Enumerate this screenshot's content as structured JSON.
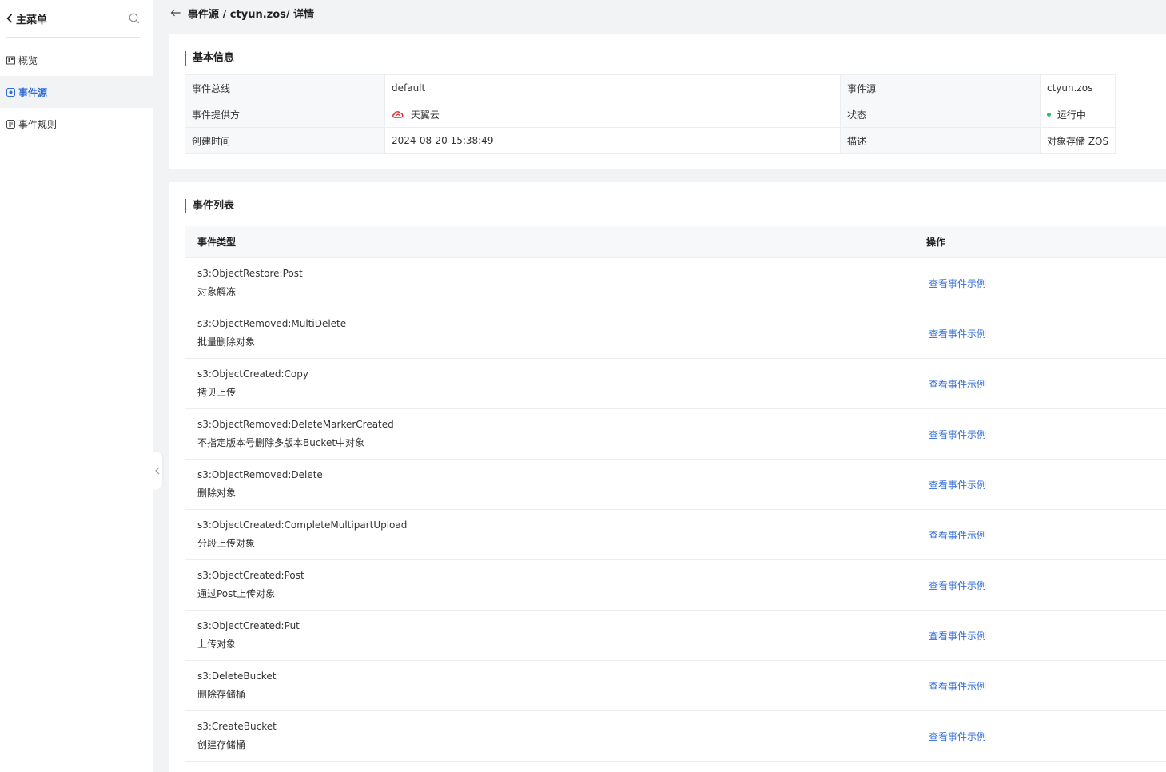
{
  "sidebar": {
    "back_label": "主菜单",
    "items": [
      {
        "label": "概览",
        "icon": "overview-icon",
        "active": false
      },
      {
        "label": "事件源",
        "icon": "event-source-icon",
        "active": true
      },
      {
        "label": "事件规则",
        "icon": "event-rule-icon",
        "active": false
      }
    ]
  },
  "header": {
    "breadcrumb": "事件源 / ctyun.zos/ 详情"
  },
  "basic_info": {
    "title": "基本信息",
    "rows": [
      {
        "label1": "事件总线",
        "value1": "default",
        "label2": "事件源",
        "value2": "ctyun.zos"
      },
      {
        "label1": "事件提供方",
        "value1": "天翼云",
        "label2": "状态",
        "value2": "运行中"
      },
      {
        "label1": "创建时间",
        "value1": "2024-08-20 15:38:49",
        "label2": "描述",
        "value2": "对象存储 ZOS"
      }
    ],
    "status_color": "#2bbf6a",
    "provider_icon_color": "#e0282e"
  },
  "event_list": {
    "title": "事件列表",
    "columns": [
      "事件类型",
      "操作"
    ],
    "action_label": "查看事件示例",
    "rows": [
      {
        "type": "s3:ObjectRestore:Post",
        "desc": "对象解冻"
      },
      {
        "type": "s3:ObjectRemoved:MultiDelete",
        "desc": "批量删除对象"
      },
      {
        "type": "s3:ObjectCreated:Copy",
        "desc": "拷贝上传"
      },
      {
        "type": "s3:ObjectRemoved:DeleteMarkerCreated",
        "desc": "不指定版本号删除多版本Bucket中对象"
      },
      {
        "type": "s3:ObjectRemoved:Delete",
        "desc": "删除对象"
      },
      {
        "type": "s3:ObjectCreated:CompleteMultipartUpload",
        "desc": "分段上传对象"
      },
      {
        "type": "s3:ObjectCreated:Post",
        "desc": "通过Post上传对象"
      },
      {
        "type": "s3:ObjectCreated:Put",
        "desc": "上传对象"
      },
      {
        "type": "s3:DeleteBucket",
        "desc": "删除存储桶"
      },
      {
        "type": "s3:CreateBucket",
        "desc": "创建存储桶"
      }
    ]
  },
  "colors": {
    "accent": "#2e6bd9",
    "background": "#f2f3f5"
  }
}
